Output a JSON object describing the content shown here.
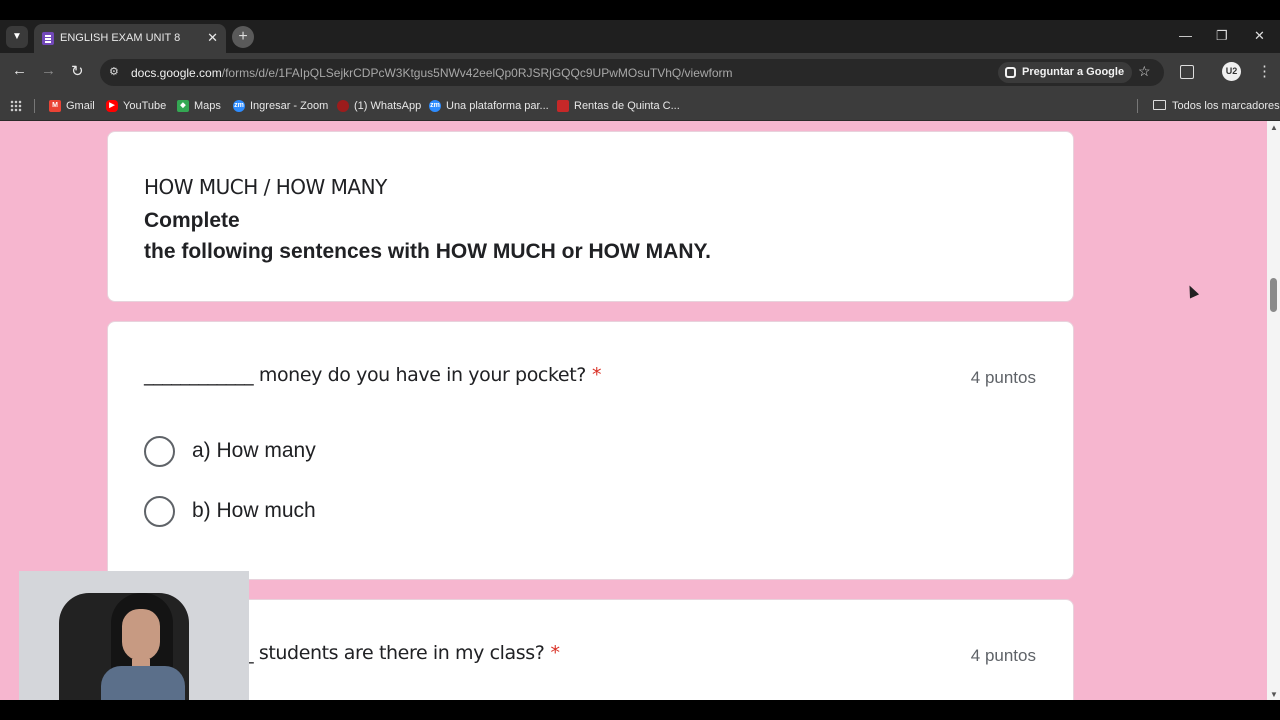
{
  "browser": {
    "tab_title": "ENGLISH EXAM UNIT 8",
    "tab_close": "✕",
    "new_tab": "+",
    "url_host": "docs.google.com",
    "url_path": "/forms/d/e/1FAIpQLSejkrCDPcW3Ktgus5NWv42eelQp0RJSRjGQQc9UPwMOsuTVhQ/viewform",
    "ask_google": "Preguntar a Google",
    "profile_initial": "U2",
    "bookmarks": [
      "Gmail",
      "YouTube",
      "Maps",
      "Ingresar - Zoom",
      "(1) WhatsApp",
      "Una plataforma par...",
      "Rentas de Quinta C..."
    ],
    "all_bookmarks": "Todos los marcadores"
  },
  "form": {
    "section": {
      "title": "HOW MUCH / HOW MANY",
      "desc_line1": "Complete",
      "desc_line2": "the following sentences with HOW MUCH or HOW MANY."
    },
    "questions": [
      {
        "text": "____________ money do you have in your pocket?",
        "required": "*",
        "points": "4 puntos",
        "options": [
          "a) How many",
          "b) How much"
        ]
      },
      {
        "text": "____________ students are there in my class?",
        "required": "*",
        "points": "4 puntos"
      }
    ]
  },
  "colors": {
    "page_background": "#f6b6cf",
    "required_star": "#d93025",
    "tab_favicon": "#7248b9"
  }
}
